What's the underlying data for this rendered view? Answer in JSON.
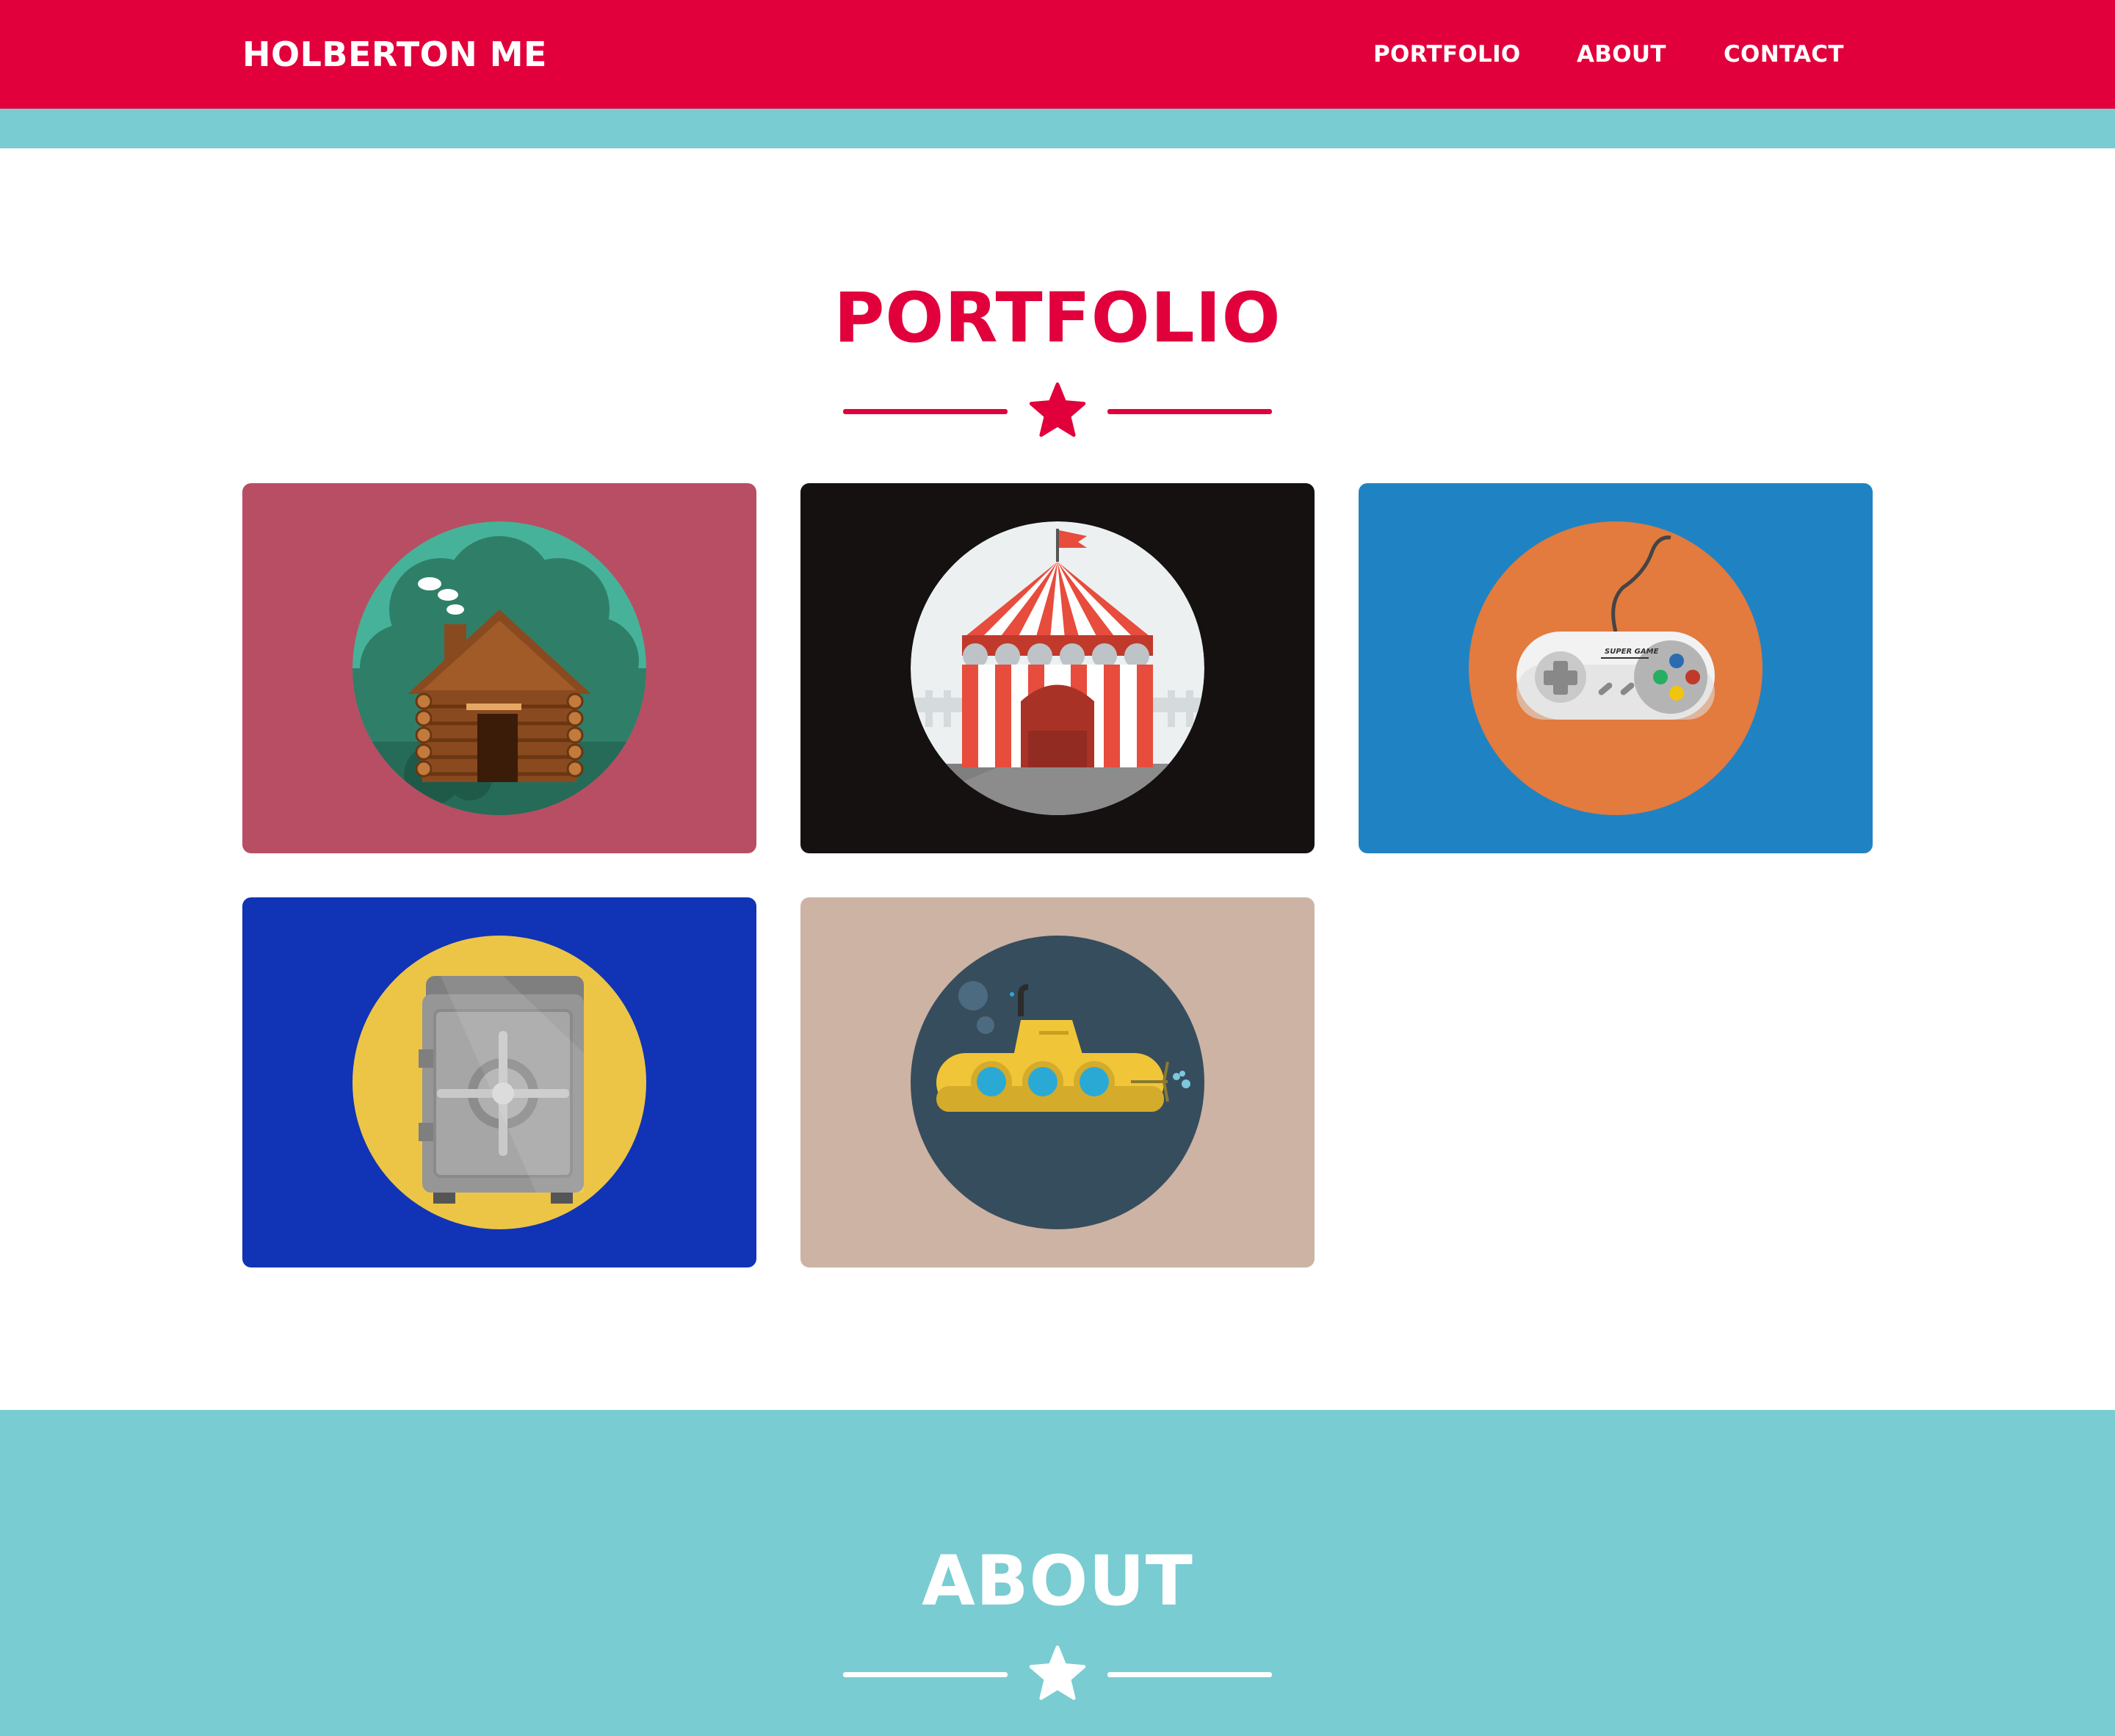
{
  "navbar": {
    "brand": "HOLBERTON ME",
    "links": [
      "PORTFOLIO",
      "ABOUT",
      "CONTACT"
    ]
  },
  "portfolio": {
    "title": "PORTFOLIO",
    "items": [
      {
        "name": "log-cabin",
        "icon": "cabin-icon",
        "background": "#b84e63",
        "circle": "#46b299"
      },
      {
        "name": "circus-tent",
        "icon": "circus-tent-icon",
        "background": "#141110",
        "circle": "#ecf0f1"
      },
      {
        "name": "game-controller",
        "icon": "gamepad-icon",
        "background": "#1f83c3",
        "circle": "#e37a3e",
        "text": "SUPER GAME"
      },
      {
        "name": "safe",
        "icon": "safe-icon",
        "background": "#1034b5",
        "circle": "#ecc547"
      },
      {
        "name": "submarine",
        "icon": "submarine-icon",
        "background": "#ccb3a4",
        "circle": "#364d5d"
      }
    ]
  },
  "about": {
    "title": "ABOUT"
  },
  "colors": {
    "primary": "#e1003b",
    "teal": "#79ccd1",
    "white": "#ffffff"
  }
}
